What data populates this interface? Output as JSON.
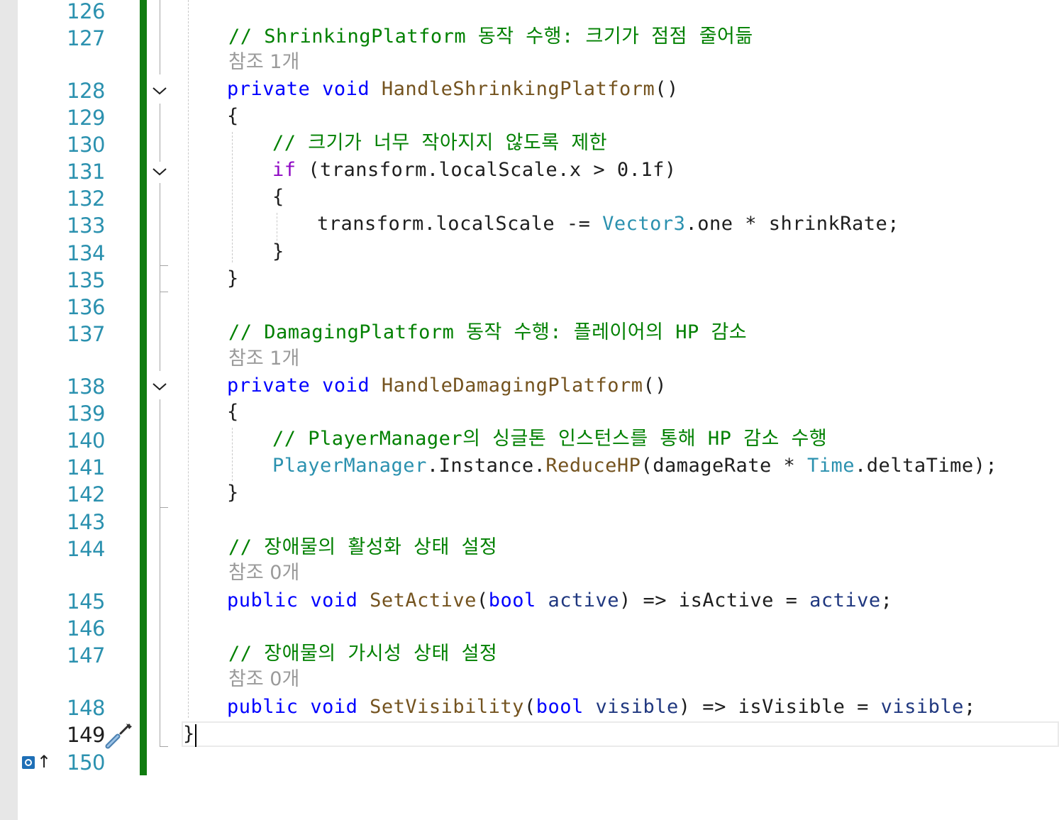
{
  "editor": {
    "line_numbers": [
      "126",
      "127",
      "128",
      "129",
      "130",
      "131",
      "132",
      "133",
      "134",
      "135",
      "136",
      "137",
      "138",
      "139",
      "140",
      "141",
      "142",
      "143",
      "144",
      "145",
      "146",
      "147",
      "148",
      "149",
      "150"
    ],
    "current_line": "149",
    "caret_after": "}",
    "change_bar_color": "#107c10",
    "glyphs": {
      "bookmark_icon": "bookmark-square-icon",
      "bookmark_arrow": "↑",
      "quick_action_icon": "screwdriver-wrench-icon",
      "fold_icon": "chevron-down-icon"
    },
    "code_lens": {
      "shrink": "참조 1개",
      "damage": "참조 1개",
      "set_active": "참조 0개",
      "set_visibility": "참조 0개"
    },
    "code": {
      "l127": "// ShrinkingPlatform 동작 수행: 크기가 점점 줄어듦",
      "l128_kw": "private",
      "l128_kw2": "void",
      "l128_name": "HandleShrinkingPlatform",
      "l128_rest": "()",
      "l129": "{",
      "l130": "// 크기가 너무 작아지지 않도록 제한",
      "l131_kw": "if",
      "l131_rest": " (transform.localScale.x > 0.1f)",
      "l132": "{",
      "l133_a": "transform.localScale -= ",
      "l133_type": "Vector3",
      "l133_b": ".one * shrinkRate;",
      "l134": "}",
      "l135": "}",
      "l137": "// DamagingPlatform 동작 수행: 플레이어의 HP 감소",
      "l138_kw": "private",
      "l138_kw2": "void",
      "l138_name": "HandleDamagingPlatform",
      "l138_rest": "()",
      "l139": "{",
      "l140": "// PlayerManager의 싱글톤 인스턴스를 통해 HP 감소 수행",
      "l141_type": "PlayerManager",
      "l141_a": ".Instance.",
      "l141_method": "ReduceHP",
      "l141_b": "(damageRate * ",
      "l141_type2": "Time",
      "l141_c": ".deltaTime);",
      "l142": "}",
      "l144": "// 장애물의 활성화 상태 설정",
      "l145_kw": "public",
      "l145_kw2": "void",
      "l145_name": "SetActive",
      "l145_a": "(",
      "l145_kw3": "bool",
      "l145_p1": "active",
      "l145_b": ") => isActive = ",
      "l145_p2": "active",
      "l145_c": ";",
      "l147": "// 장애물의 가시성 상태 설정",
      "l148_kw": "public",
      "l148_kw2": "void",
      "l148_name": "SetVisibility",
      "l148_a": "(",
      "l148_kw3": "bool",
      "l148_p1": "visible",
      "l148_b": ") => isVisible = ",
      "l148_p2": "visible",
      "l148_c": ";",
      "l149": "}"
    },
    "colors": {
      "keyword": "#0000ff",
      "type": "#2b91af",
      "method": "#74531f",
      "comment": "#008000",
      "parameter": "#1f377f",
      "line_number": "#2b91af"
    }
  }
}
